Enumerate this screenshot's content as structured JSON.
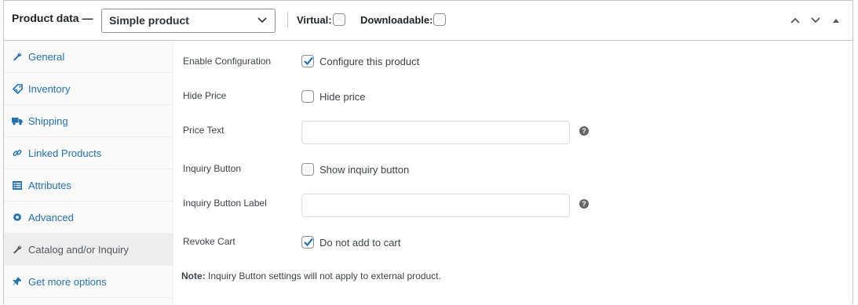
{
  "header": {
    "title": "Product data —",
    "product_type": {
      "selected": "Simple product"
    },
    "virtual_label": "Virtual:",
    "downloadable_label": "Downloadable:",
    "actions": [
      "move-up",
      "move-down",
      "toggle-panel"
    ]
  },
  "tabs": [
    {
      "label": "General",
      "icon": "wrench-icon",
      "active": false
    },
    {
      "label": "Inventory",
      "icon": "tag-icon",
      "active": false
    },
    {
      "label": "Shipping",
      "icon": "truck-icon",
      "active": false
    },
    {
      "label": "Linked Products",
      "icon": "link-icon",
      "active": false
    },
    {
      "label": "Attributes",
      "icon": "list-icon",
      "active": false
    },
    {
      "label": "Advanced",
      "icon": "gear-icon",
      "active": false
    },
    {
      "label": "Catalog and/or Inquiry",
      "icon": "wrench-icon",
      "active": true
    },
    {
      "label": "Get more options",
      "icon": "plugin-icon",
      "active": false
    }
  ],
  "fields": {
    "enable_configuration": {
      "label": "Enable Configuration",
      "option": "Configure this product",
      "checked": true
    },
    "hide_price": {
      "label": "Hide Price",
      "option": "Hide price",
      "checked": false
    },
    "price_text": {
      "label": "Price Text",
      "value": "",
      "help": "?"
    },
    "inquiry_button": {
      "label": "Inquiry Button",
      "option": "Show inquiry button",
      "checked": false
    },
    "inquiry_button_label": {
      "label": "Inquiry Button Label",
      "value": "",
      "help": "?"
    },
    "revoke_cart": {
      "label": "Revoke Cart",
      "option": "Do not add to cart",
      "checked": true
    }
  },
  "note": {
    "prefix": "Note:",
    "text": " Inquiry Button settings will not apply to external product."
  },
  "colors": {
    "link": "#2271b1",
    "checkmark": "#2271b1",
    "border": "#c3c4c7",
    "active_tab_bg": "#eeeeee"
  }
}
